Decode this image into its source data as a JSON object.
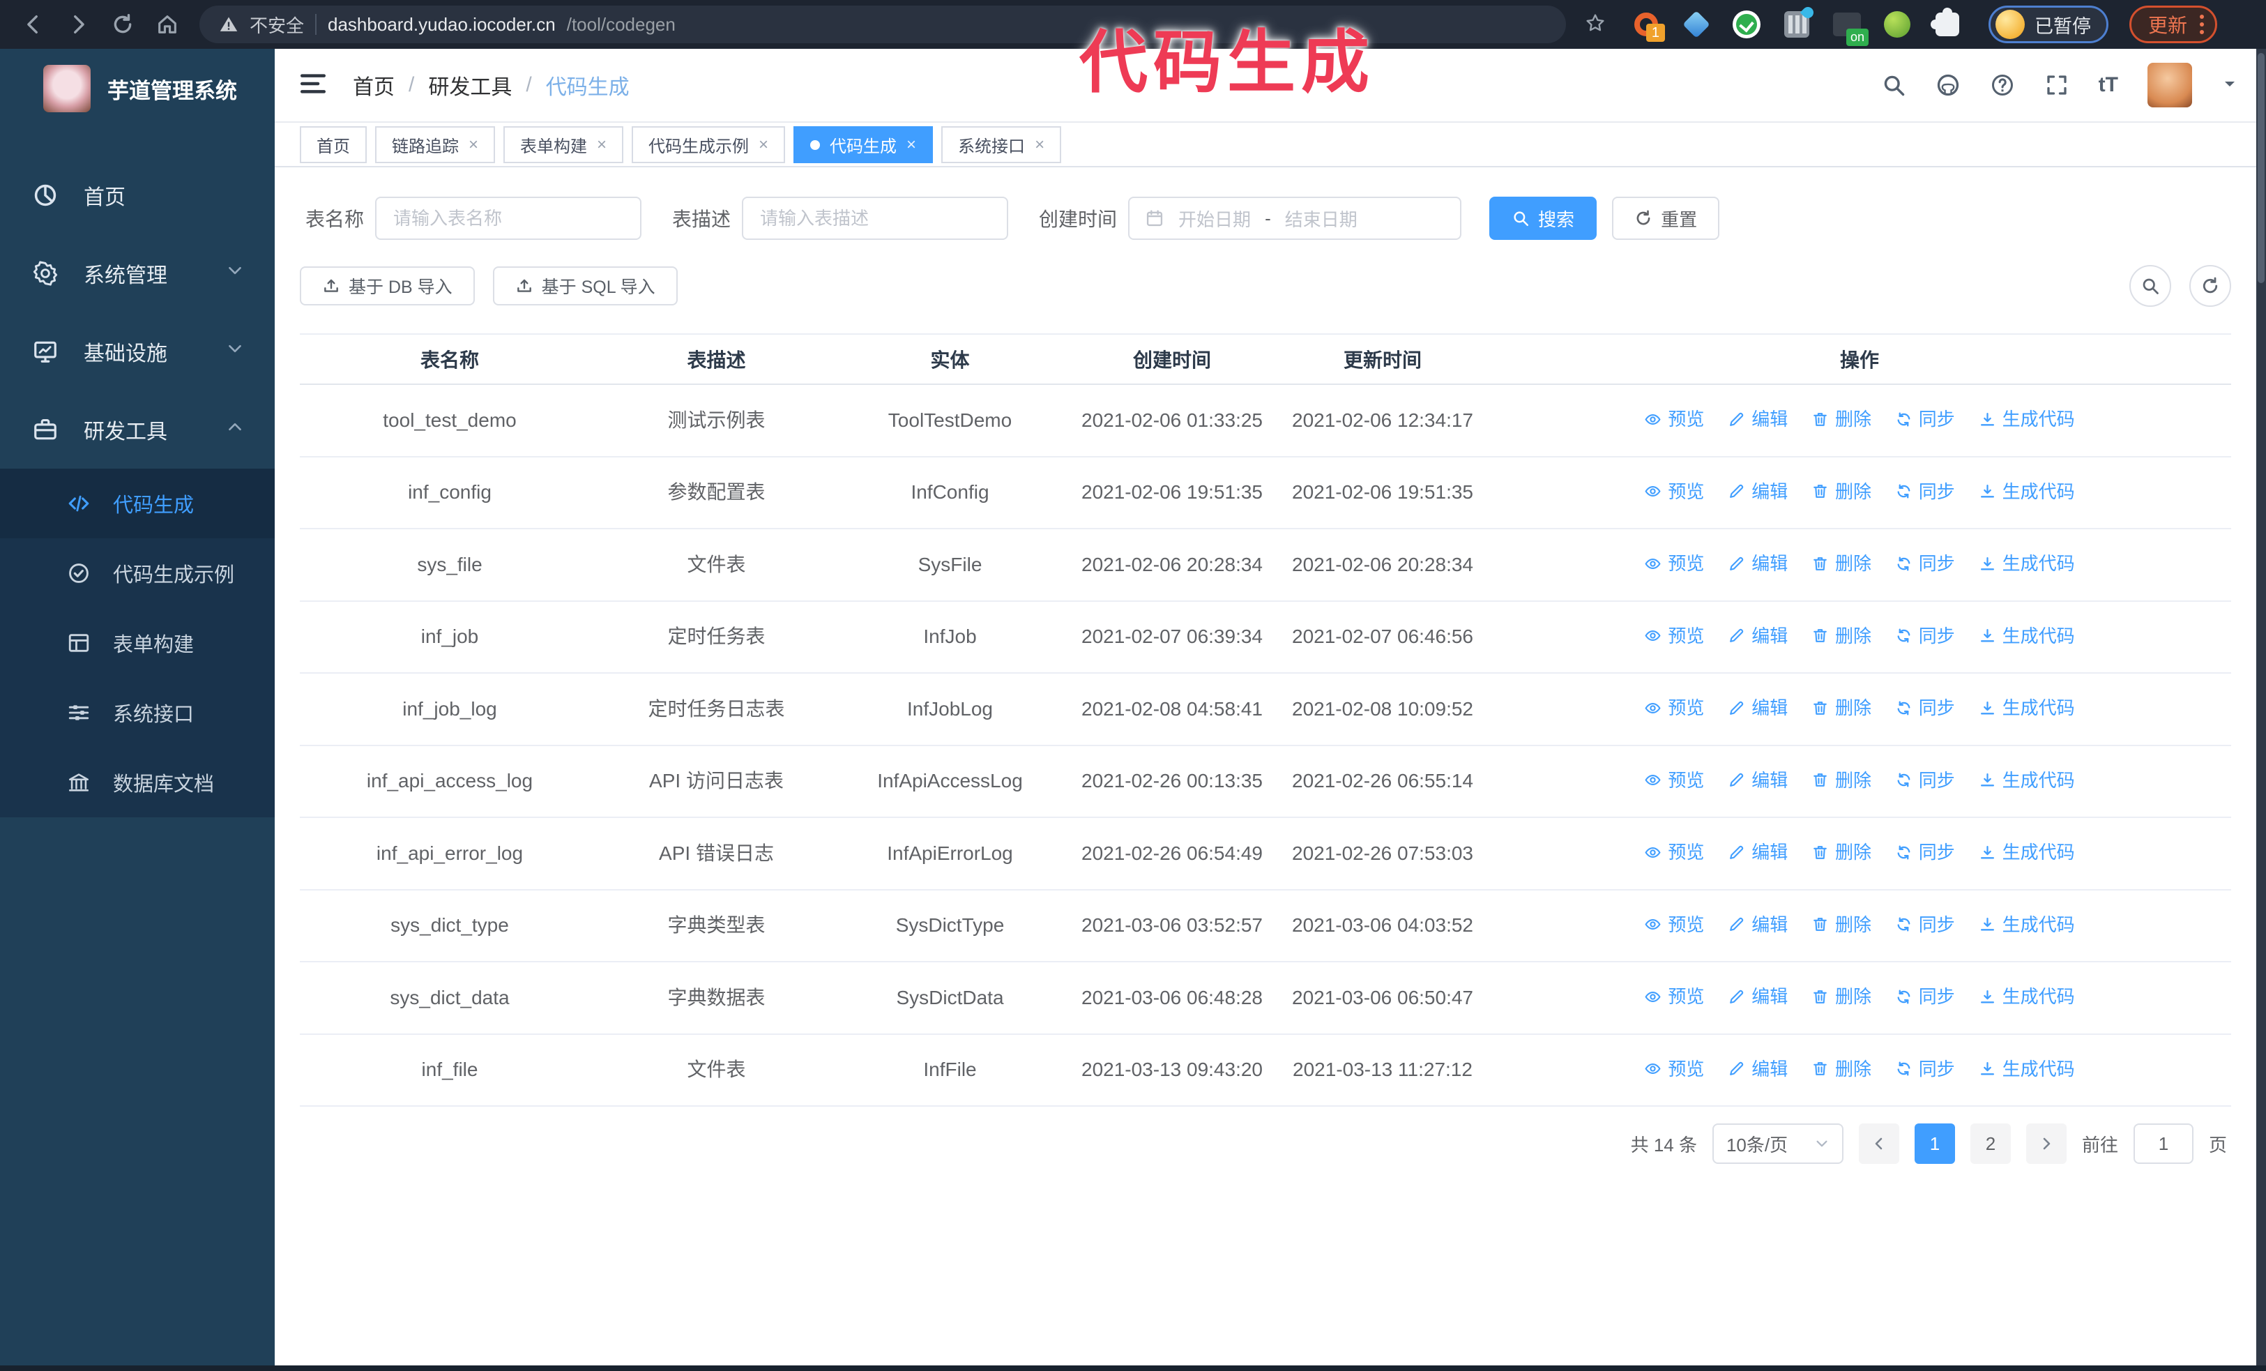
{
  "browser": {
    "security_label": "不安全",
    "url_host": "dashboard.yudao.iocoder.cn",
    "url_path": "/tool/codegen",
    "extension_badge": "1",
    "extension_on_badge": "on",
    "profile_chip_label": "已暂停",
    "update_button_label": "更新"
  },
  "annotation": {
    "text": "代码生成",
    "color": "#ee3b55"
  },
  "sidebar": {
    "title": "芋道管理系统",
    "menu": [
      {
        "label": "首页",
        "icon": "dashboard-icon",
        "expandable": false
      },
      {
        "label": "系统管理",
        "icon": "gear-icon",
        "expandable": true,
        "expanded": false
      },
      {
        "label": "基础设施",
        "icon": "monitor-icon",
        "expandable": true,
        "expanded": false
      },
      {
        "label": "研发工具",
        "icon": "toolbox-icon",
        "expandable": true,
        "expanded": true
      }
    ],
    "submenu": [
      {
        "label": "代码生成",
        "icon": "code-icon",
        "active": true
      },
      {
        "label": "代码生成示例",
        "icon": "shield-check-icon",
        "active": false
      },
      {
        "label": "表单构建",
        "icon": "form-icon",
        "active": false
      },
      {
        "label": "系统接口",
        "icon": "sliders-icon",
        "active": false
      },
      {
        "label": "数据库文档",
        "icon": "database-icon",
        "active": false
      }
    ]
  },
  "header": {
    "breadcrumb": [
      "首页",
      "研发工具",
      "代码生成"
    ],
    "separator": "/",
    "font_size_icon_label": "tT"
  },
  "tabs": [
    {
      "label": "首页",
      "closable": false,
      "active": false
    },
    {
      "label": "链路追踪",
      "closable": true,
      "active": false
    },
    {
      "label": "表单构建",
      "closable": true,
      "active": false
    },
    {
      "label": "代码生成示例",
      "closable": true,
      "active": false
    },
    {
      "label": "代码生成",
      "closable": true,
      "active": true
    },
    {
      "label": "系统接口",
      "closable": true,
      "active": false
    }
  ],
  "filters": {
    "table_name_label": "表名称",
    "table_name_placeholder": "请输入表名称",
    "table_desc_label": "表描述",
    "table_desc_placeholder": "请输入表描述",
    "create_time_label": "创建时间",
    "date_start_placeholder": "开始日期",
    "date_separator": "-",
    "date_end_placeholder": "结束日期",
    "search_button": "搜索",
    "reset_button": "重置"
  },
  "toolbar": {
    "import_db_button": "基于 DB 导入",
    "import_sql_button": "基于 SQL 导入"
  },
  "table": {
    "columns": [
      "表名称",
      "表描述",
      "实体",
      "创建时间",
      "更新时间",
      "操作"
    ],
    "actions": [
      "预览",
      "编辑",
      "删除",
      "同步",
      "生成代码"
    ],
    "rows": [
      {
        "name": "tool_test_demo",
        "desc": "测试示例表",
        "entity": "ToolTestDemo",
        "created": "2021-02-06 01:33:25",
        "updated": "2021-02-06 12:34:17"
      },
      {
        "name": "inf_config",
        "desc": "参数配置表",
        "entity": "InfConfig",
        "created": "2021-02-06 19:51:35",
        "updated": "2021-02-06 19:51:35"
      },
      {
        "name": "sys_file",
        "desc": "文件表",
        "entity": "SysFile",
        "created": "2021-02-06 20:28:34",
        "updated": "2021-02-06 20:28:34"
      },
      {
        "name": "inf_job",
        "desc": "定时任务表",
        "entity": "InfJob",
        "created": "2021-02-07 06:39:34",
        "updated": "2021-02-07 06:46:56"
      },
      {
        "name": "inf_job_log",
        "desc": "定时任务日志表",
        "entity": "InfJobLog",
        "created": "2021-02-08 04:58:41",
        "updated": "2021-02-08 10:09:52"
      },
      {
        "name": "inf_api_access_log",
        "desc": "API 访问日志表",
        "entity": "InfApiAccessLog",
        "created": "2021-02-26 00:13:35",
        "updated": "2021-02-26 06:55:14"
      },
      {
        "name": "inf_api_error_log",
        "desc": "API 错误日志",
        "entity": "InfApiErrorLog",
        "created": "2021-02-26 06:54:49",
        "updated": "2021-02-26 07:53:03"
      },
      {
        "name": "sys_dict_type",
        "desc": "字典类型表",
        "entity": "SysDictType",
        "created": "2021-03-06 03:52:57",
        "updated": "2021-03-06 04:03:52"
      },
      {
        "name": "sys_dict_data",
        "desc": "字典数据表",
        "entity": "SysDictData",
        "created": "2021-03-06 06:48:28",
        "updated": "2021-03-06 06:50:47"
      },
      {
        "name": "inf_file",
        "desc": "文件表",
        "entity": "InfFile",
        "created": "2021-03-13 09:43:20",
        "updated": "2021-03-13 11:27:12"
      }
    ]
  },
  "pagination": {
    "total_text": "共 14 条",
    "page_size": "10条/页",
    "pages": [
      "1",
      "2"
    ],
    "active_page": "1",
    "goto_label": "前往",
    "goto_value": "1",
    "goto_suffix": "页"
  },
  "colors": {
    "primary": "#409eff",
    "sidebar_bg": "#204058",
    "submenu_bg": "#19334c",
    "annotation": "#ee3b55",
    "browser_bar_bg": "#1d2430"
  }
}
